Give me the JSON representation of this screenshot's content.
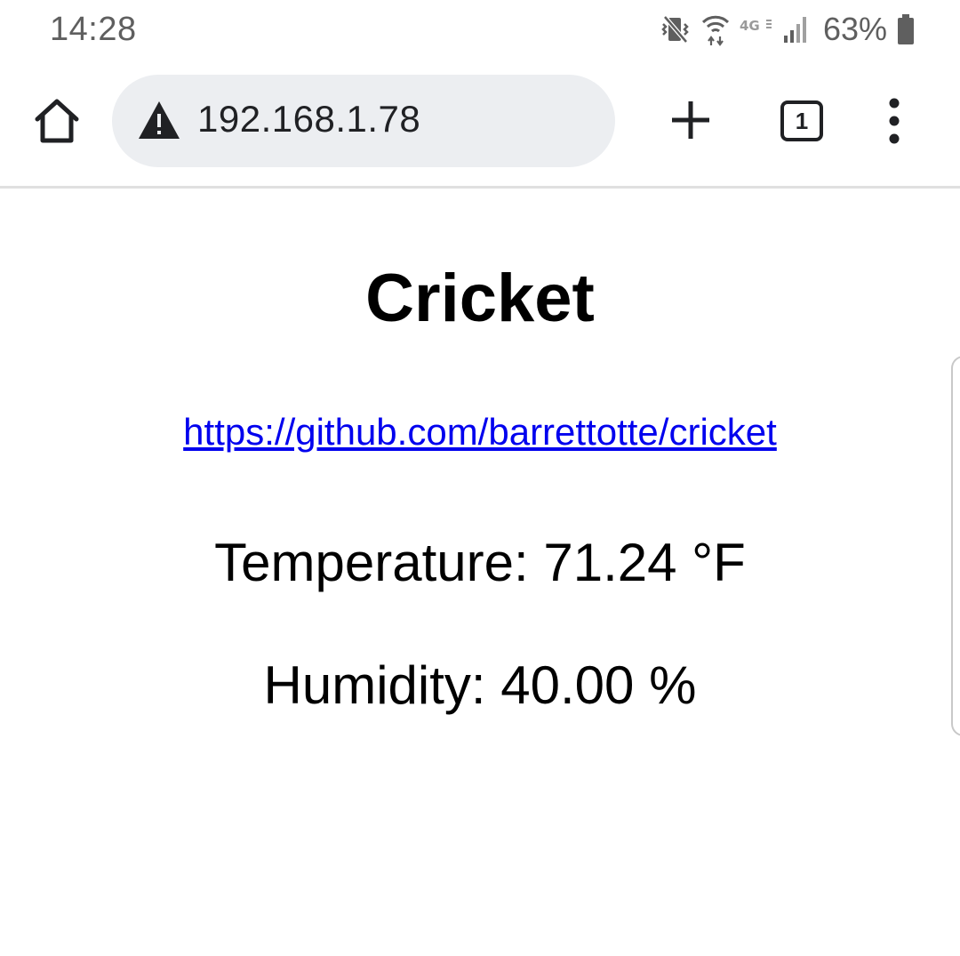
{
  "status_bar": {
    "time": "14:28",
    "network_label": "4G",
    "battery_percent": "63%",
    "icons": [
      "mute-vibrate-icon",
      "wifi-icon",
      "lte-icon",
      "signal-icon",
      "battery-icon"
    ]
  },
  "toolbar": {
    "url": "192.168.1.78",
    "tab_count": "1",
    "icons": [
      "home-icon",
      "warning-icon",
      "plus-icon",
      "menu-dots-icon"
    ]
  },
  "page": {
    "heading": "Cricket",
    "link": "https://github.com/barrettotte/cricket",
    "temperature": "Temperature: 71.24 °F",
    "humidity": "Humidity: 40.00 %"
  },
  "colors": {
    "link": "#0000ee",
    "omnibox_bg": "#eceef1",
    "status_text": "#5f5f5f"
  }
}
